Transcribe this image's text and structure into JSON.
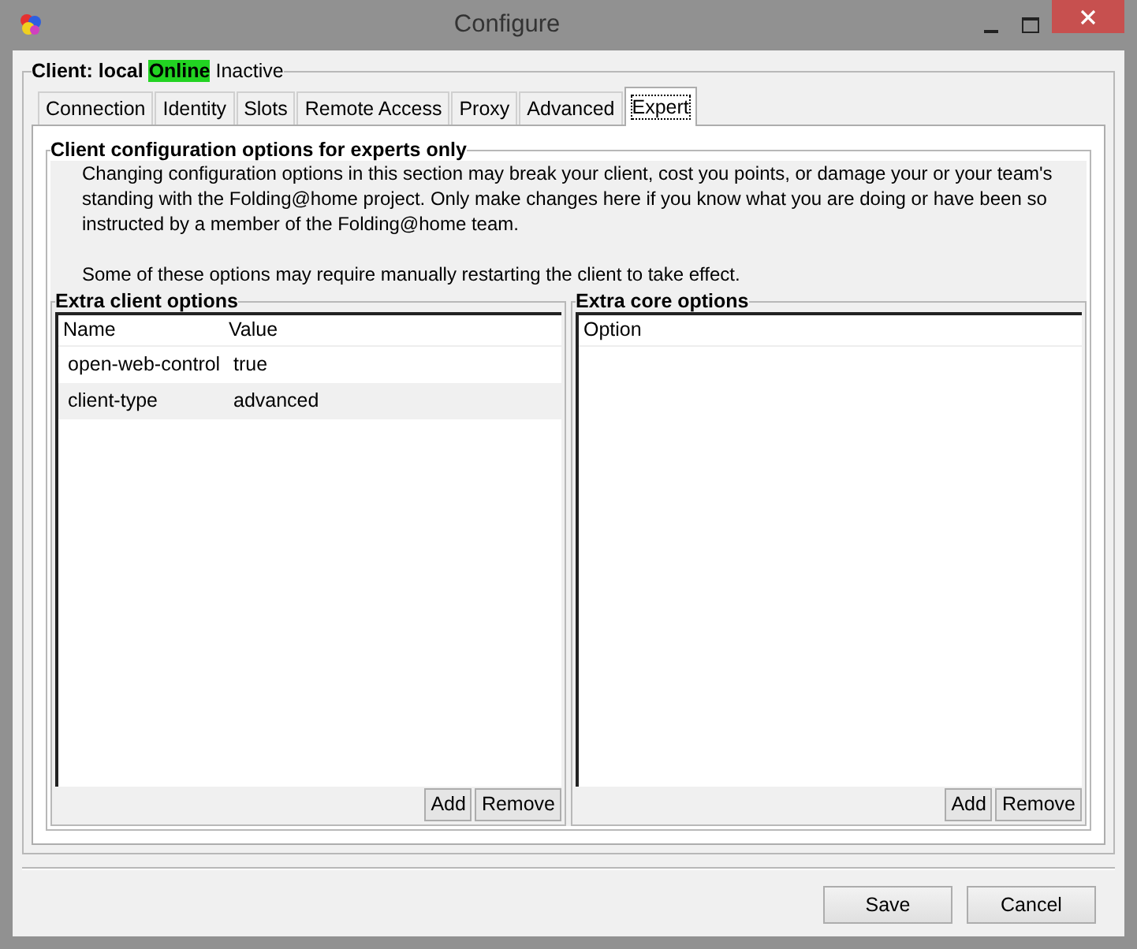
{
  "window": {
    "title": "Configure"
  },
  "client": {
    "label": "Client: local",
    "status": "Online",
    "state": "Inactive"
  },
  "tabs": [
    {
      "label": "Connection",
      "selected": false
    },
    {
      "label": "Identity",
      "selected": false
    },
    {
      "label": "Slots",
      "selected": false
    },
    {
      "label": "Remote Access",
      "selected": false
    },
    {
      "label": "Proxy",
      "selected": false
    },
    {
      "label": "Advanced",
      "selected": false
    },
    {
      "label": "Expert",
      "selected": true
    }
  ],
  "section": {
    "title": "Client configuration options for experts only",
    "paragraphs": [
      "Changing configuration options in this section may break your client, cost you points, or damage your or your team's standing with the Folding@home project.  Only make changes here if you know what you are doing or have been so instructed by a member of the Folding@home team.",
      "Some of these options may require manually restarting the client to take effect."
    ]
  },
  "client_options": {
    "title": "Extra client options",
    "columns": [
      "Name",
      "Value"
    ],
    "rows": [
      {
        "cells": [
          "open-web-control",
          "true"
        ],
        "selected": false
      },
      {
        "cells": [
          "client-type",
          "advanced"
        ],
        "selected": true
      }
    ],
    "buttons": [
      "Add",
      "Remove"
    ]
  },
  "core_options": {
    "title": "Extra core options",
    "columns": [
      "Option"
    ],
    "buttons": [
      "Add",
      "Remove"
    ]
  },
  "buttons": [
    "Save",
    "Cancel"
  ]
}
